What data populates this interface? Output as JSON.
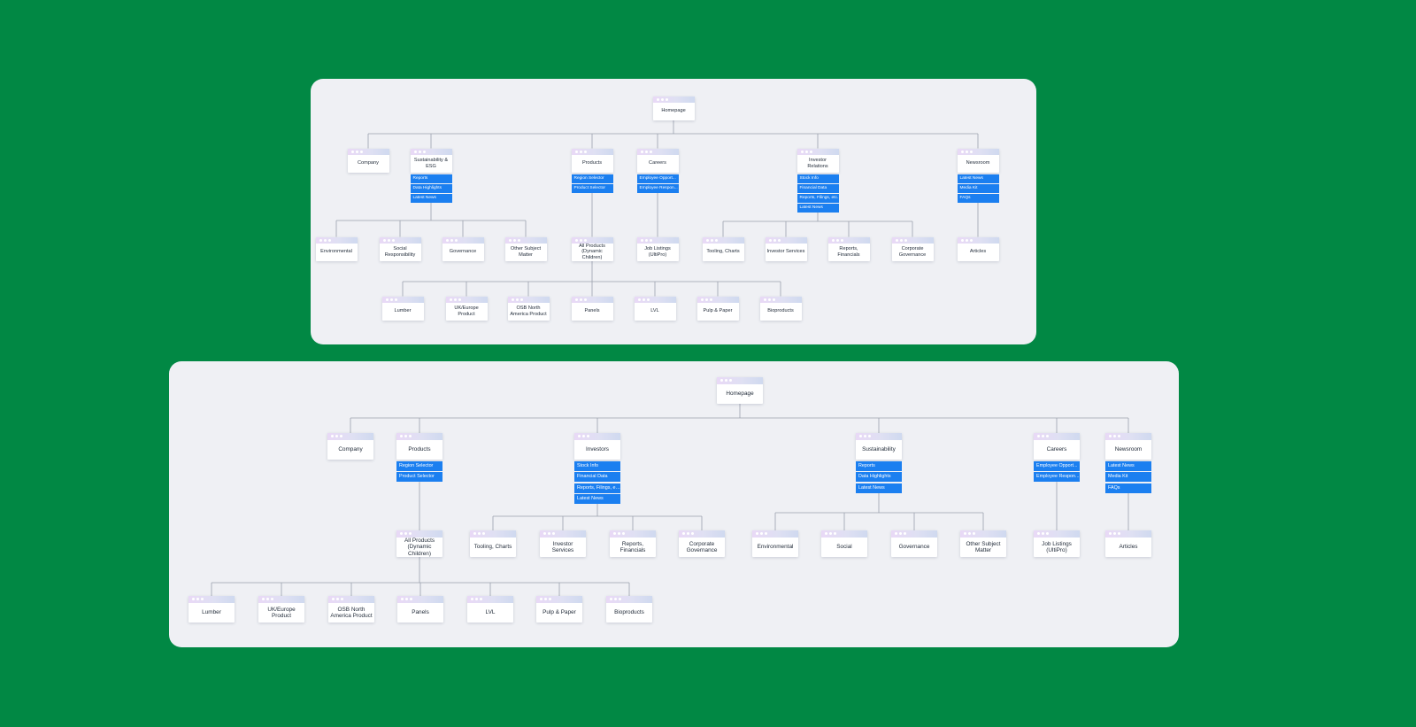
{
  "panels": [
    {
      "root": {
        "label": "Homepage"
      },
      "sections": [
        {
          "label": "Company"
        },
        {
          "label": "Sustainability & ESG",
          "tags": [
            "Reports",
            "Data Highlights",
            "Latest News"
          ]
        },
        {
          "label": "Products",
          "tags": [
            "Region Selector",
            "Product Selector"
          ]
        },
        {
          "label": "Careers",
          "tags": [
            "Employee Opport...",
            "Employee Respon..."
          ]
        },
        {
          "label": "Investor Relations",
          "tags": [
            "Stock Info",
            "Financial Data",
            "Reports, Filings, etc.",
            "Latest News"
          ]
        },
        {
          "label": "Newsroom",
          "tags": [
            "Latest News",
            "Media Kit",
            "FAQs"
          ]
        }
      ],
      "level2": [
        {
          "label": "Environmental"
        },
        {
          "label": "Social Responsibility"
        },
        {
          "label": "Governance"
        },
        {
          "label": "Other Subject Matter"
        },
        {
          "label": "All Products (Dynamic Children)"
        },
        {
          "label": "Job Listings (UltiPro)"
        },
        {
          "label": "Tooling, Charts"
        },
        {
          "label": "Investor Services"
        },
        {
          "label": "Reports, Financials"
        },
        {
          "label": "Corporate Governance"
        },
        {
          "label": "Articles"
        }
      ],
      "level3": [
        {
          "label": "Lumber"
        },
        {
          "label": "UK/Europe Product"
        },
        {
          "label": "OSB North America Product"
        },
        {
          "label": "Panels"
        },
        {
          "label": "LVL"
        },
        {
          "label": "Pulp & Paper"
        },
        {
          "label": "Bioproducts"
        }
      ]
    },
    {
      "root": {
        "label": "Homepage"
      },
      "sections": [
        {
          "label": "Company"
        },
        {
          "label": "Products",
          "tags": [
            "Region Selector",
            "Product Selector"
          ]
        },
        {
          "label": "Investors",
          "tags": [
            "Stock Info",
            "Financial Data",
            "Reports, Filings, etc.",
            "Latest News"
          ]
        },
        {
          "label": "Sustainability",
          "tags": [
            "Reports",
            "Data Highlights",
            "Latest News"
          ]
        },
        {
          "label": "Careers",
          "tags": [
            "Employee Opport...",
            "Employee Respon..."
          ]
        },
        {
          "label": "Newsroom",
          "tags": [
            "Latest News",
            "Media Kit",
            "FAQs"
          ]
        }
      ],
      "level2": [
        {
          "label": "All Products (Dynamic Children)"
        },
        {
          "label": "Tooling, Charts"
        },
        {
          "label": "Investor Services"
        },
        {
          "label": "Reports, Financials"
        },
        {
          "label": "Corporate Governance"
        },
        {
          "label": "Environmental"
        },
        {
          "label": "Social"
        },
        {
          "label": "Governance"
        },
        {
          "label": "Other Subject Matter"
        },
        {
          "label": "Job Listings (UltiPro)"
        },
        {
          "label": "Articles"
        }
      ],
      "level3": [
        {
          "label": "Lumber"
        },
        {
          "label": "UK/Europe Product"
        },
        {
          "label": "OSB North America Product"
        },
        {
          "label": "Panels"
        },
        {
          "label": "LVL"
        },
        {
          "label": "Pulp & Paper"
        },
        {
          "label": "Bioproducts"
        }
      ]
    }
  ]
}
